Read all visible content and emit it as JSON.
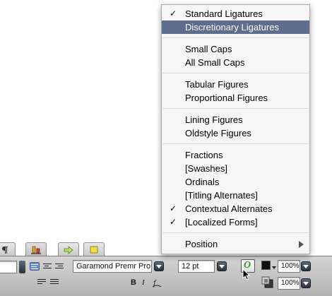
{
  "menu": {
    "groups": [
      [
        {
          "label": "Standard Ligatures",
          "checked": true,
          "highlighted": false
        },
        {
          "label": "Discretionary Ligatures",
          "checked": false,
          "highlighted": true
        }
      ],
      [
        {
          "label": "Small Caps",
          "checked": false,
          "highlighted": false
        },
        {
          "label": "All Small Caps",
          "checked": false,
          "highlighted": false
        }
      ],
      [
        {
          "label": "Tabular Figures",
          "checked": false,
          "highlighted": false
        },
        {
          "label": "Proportional Figures",
          "checked": false,
          "highlighted": false
        }
      ],
      [
        {
          "label": "Lining Figures",
          "checked": false,
          "highlighted": false
        },
        {
          "label": "Oldstyle Figures",
          "checked": false,
          "highlighted": false
        }
      ],
      [
        {
          "label": "Fractions",
          "checked": false,
          "highlighted": false
        },
        {
          "label": "[Swashes]",
          "checked": false,
          "highlighted": false
        },
        {
          "label": "Ordinals",
          "checked": false,
          "highlighted": false
        },
        {
          "label": "[Titling Alternates]",
          "checked": false,
          "highlighted": false
        },
        {
          "label": "Contextual Alternates",
          "checked": true,
          "highlighted": false
        },
        {
          "label": "[Localized Forms]",
          "checked": true,
          "highlighted": false
        }
      ],
      [
        {
          "label": "Position",
          "checked": false,
          "highlighted": false,
          "submenu": true
        }
      ]
    ],
    "check_glyph": "✓"
  },
  "toolbar": {
    "font_family": "Garamond Premr Pro",
    "font_size": "12 pt",
    "scale_horizontal": "100%",
    "scale_vertical": "100%",
    "bold": "B",
    "italic": "I",
    "opentype_glyph": "O",
    "highlight_color": "#6f8fd0",
    "opentype_button_color": "#3d8a2e"
  },
  "tabs": [
    {
      "icon": "paragraph-icon"
    },
    {
      "icon": "align-bars-icon"
    },
    {
      "icon": "arrow-right-icon"
    },
    {
      "icon": "yellow-square-icon"
    }
  ]
}
